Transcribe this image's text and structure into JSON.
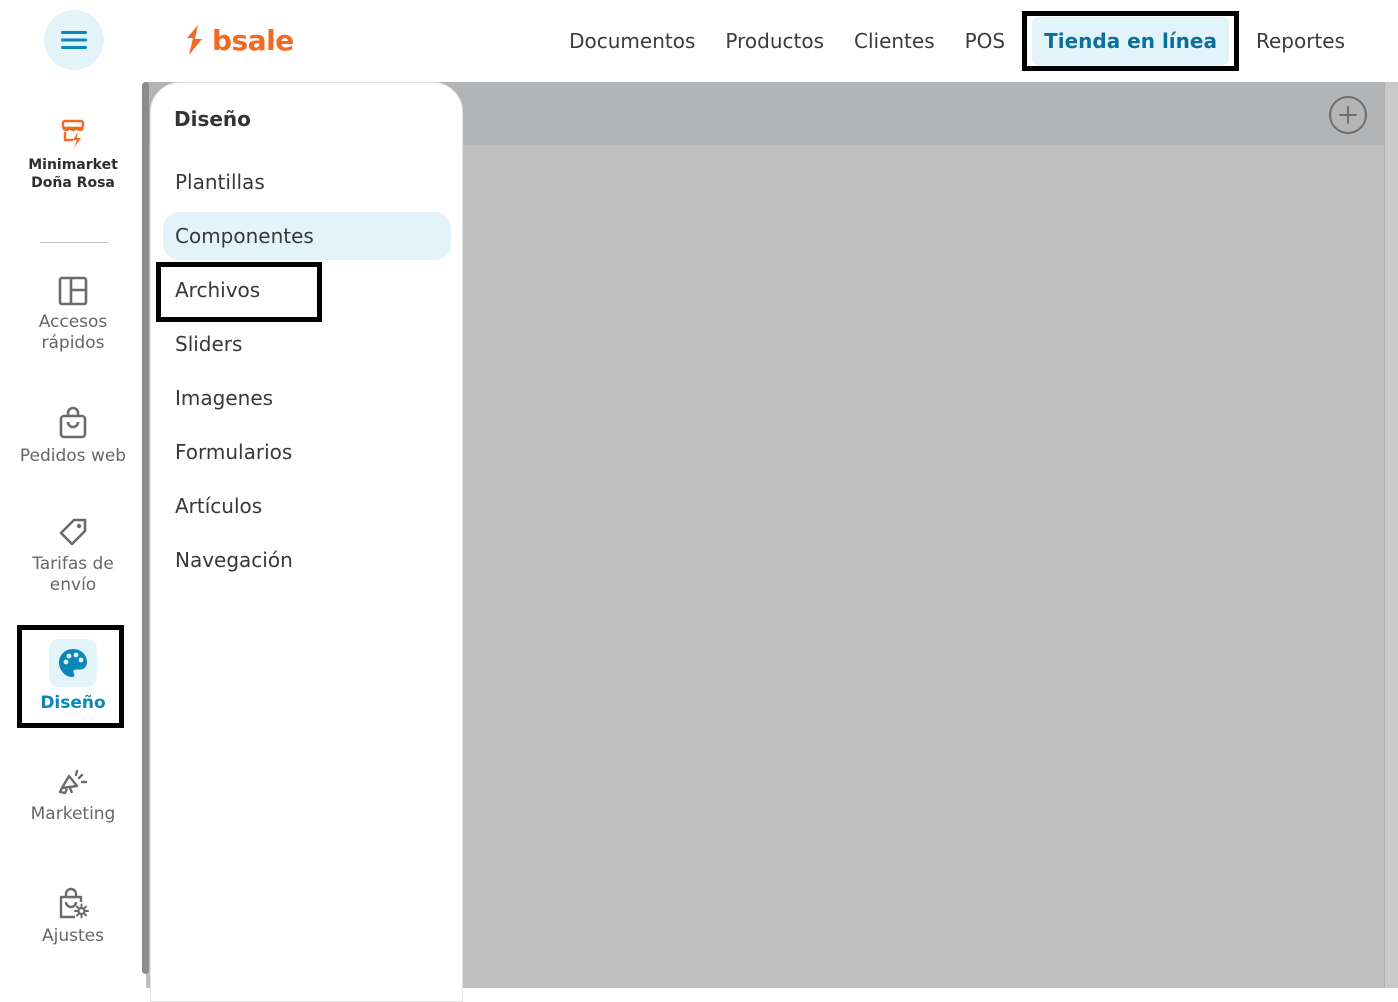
{
  "brand": {
    "logo_text": "bsale",
    "accent": "#f26a21",
    "active_color": "#0a87b8",
    "active_bg": "#e3f3fa"
  },
  "topnav": {
    "items": [
      {
        "label": "Documentos"
      },
      {
        "label": "Productos"
      },
      {
        "label": "Clientes"
      },
      {
        "label": "POS"
      },
      {
        "label": "Tienda en línea",
        "active": true
      },
      {
        "label": "Reportes"
      }
    ]
  },
  "store": {
    "name_line1": "Minimarket",
    "name_line2": "Doña Rosa",
    "icon": "store-icon"
  },
  "sidebar": {
    "items": [
      {
        "label_line1": "Accesos",
        "label_line2": "rápidos",
        "icon": "layout-icon"
      },
      {
        "label_line1": "Pedidos web",
        "label_line2": "",
        "icon": "shopping-bag-icon"
      },
      {
        "label_line1": "Tarifas de",
        "label_line2": "envío",
        "icon": "tag-icon"
      },
      {
        "label_line1": "Diseño",
        "label_line2": "",
        "icon": "palette-icon",
        "active": true
      },
      {
        "label_line1": "Marketing",
        "label_line2": "",
        "icon": "megaphone-icon"
      },
      {
        "label_line1": "Ajustes",
        "label_line2": "",
        "icon": "settings-bag-icon"
      }
    ]
  },
  "submenu": {
    "title": "Diseño",
    "items": [
      {
        "label": "Plantillas"
      },
      {
        "label": "Componentes",
        "active": true
      },
      {
        "label": "Archivos"
      },
      {
        "label": "Sliders"
      },
      {
        "label": "Imagenes"
      },
      {
        "label": "Formularios"
      },
      {
        "label": "Artículos"
      },
      {
        "label": "Navegación"
      }
    ]
  },
  "main": {
    "add_icon": "plus-circle-icon"
  }
}
